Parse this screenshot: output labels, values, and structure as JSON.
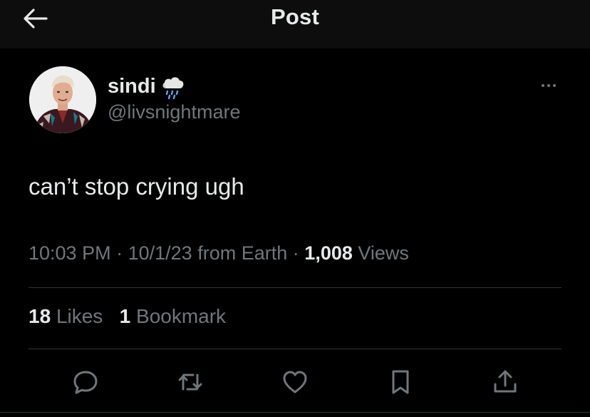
{
  "header": {
    "title": "Post",
    "back_icon": "arrow-left-icon"
  },
  "post": {
    "author": {
      "display_name": "sindi",
      "name_emoji_icon": "cloud-rain-icon",
      "handle": "@livsnightmare"
    },
    "more_icon": "more-horizontal-icon",
    "text": "can’t stop crying ugh",
    "meta": {
      "time": "10:03 PM",
      "separator": "·",
      "date": "10/1/23",
      "source": "from Earth",
      "views_count": "1,008",
      "views_label": "Views"
    },
    "stats": {
      "likes_count": "18",
      "likes_label": "Likes",
      "bookmarks_count": "1",
      "bookmarks_label": "Bookmark"
    },
    "actions": [
      {
        "name": "reply",
        "icon": "reply-icon"
      },
      {
        "name": "repost",
        "icon": "repost-icon"
      },
      {
        "name": "like",
        "icon": "heart-icon"
      },
      {
        "name": "bookmark",
        "icon": "bookmark-icon"
      },
      {
        "name": "share",
        "icon": "share-icon"
      }
    ]
  },
  "colors": {
    "background": "#000000",
    "header_background": "#0d0d0d",
    "primary_text": "#e7e9ea",
    "secondary_text": "#71767b",
    "divider": "#2f3336"
  }
}
